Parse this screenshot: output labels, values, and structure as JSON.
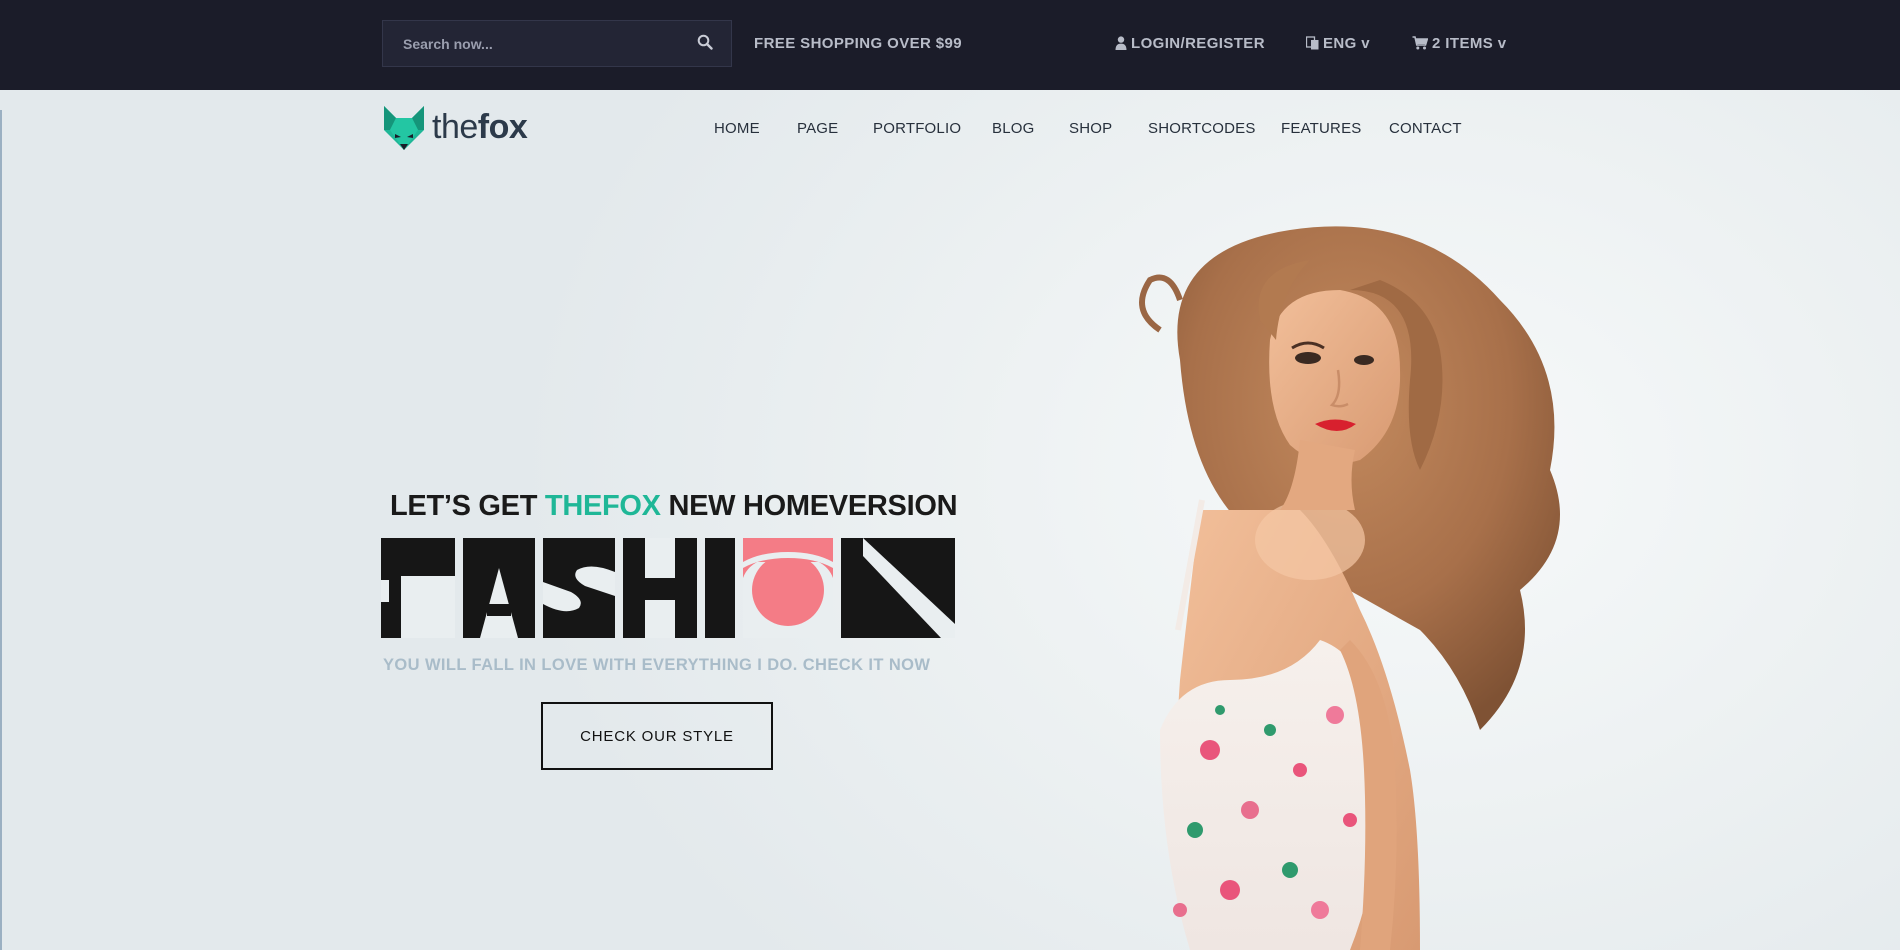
{
  "topbar": {
    "search_placeholder": "Search now...",
    "search_icon": "search-icon",
    "shipping_text": "FREE SHOPPING OVER $99",
    "login_label": "LOGIN/REGISTER",
    "login_icon": "user-icon",
    "language_label": "ENG v",
    "language_icon": "language-icon",
    "cart_label": "2 ITEMS v",
    "cart_icon": "cart-icon"
  },
  "header": {
    "logo_text_light": "the",
    "logo_text_bold": "fox",
    "nav": [
      {
        "label": "HOME"
      },
      {
        "label": "PAGE"
      },
      {
        "label": "PORTFOLIO"
      },
      {
        "label": "BLOG"
      },
      {
        "label": "SHOP"
      },
      {
        "label": "SHORTCODES"
      },
      {
        "label": "FEATURES"
      },
      {
        "label": "CONTACT"
      }
    ]
  },
  "hero": {
    "kicker_prefix": "LET’S GET ",
    "kicker_accent": "THEFOX",
    "kicker_suffix": " NEW HOMEVERSION",
    "headline": "FASHION",
    "tagline": "YOU WILL FALL IN LOVE WITH EVERYTHING I DO. CHECK IT NOW",
    "cta_label": "CHECK OUR STYLE"
  },
  "colors": {
    "topbar_bg": "#1b1c29",
    "accent": "#1fb797",
    "headline_dark": "#161616",
    "headline_pink": "#f47c86",
    "tagline": "#a9bcc9"
  }
}
